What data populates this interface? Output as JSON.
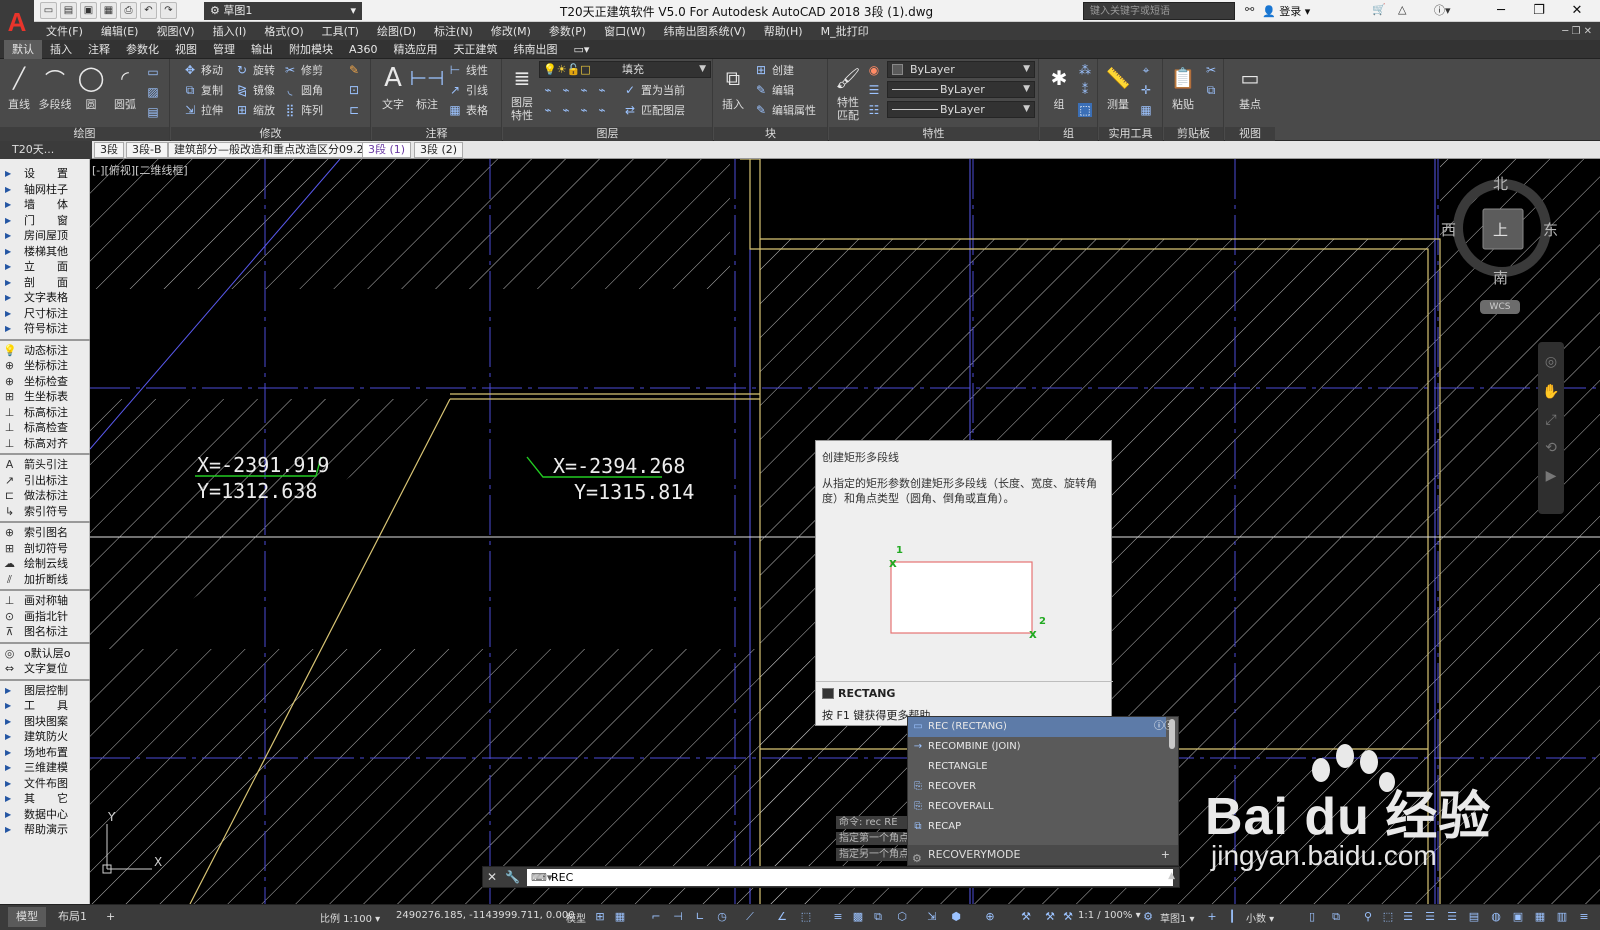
{
  "titlebar": {
    "workspace": "草图1",
    "title": "T20天正建筑软件 V5.0 For Autodesk AutoCAD 2018    3段 (1).dwg",
    "search_placeholder": "键入关键字或短语",
    "login": "登录"
  },
  "menus": [
    "文件(F)",
    "编辑(E)",
    "视图(V)",
    "插入(I)",
    "格式(O)",
    "工具(T)",
    "绘图(D)",
    "标注(N)",
    "修改(M)",
    "参数(P)",
    "窗口(W)",
    "纬南出图系统(V)",
    "帮助(H)",
    "M_批打印"
  ],
  "ribbon_tabs": [
    "默认",
    "插入",
    "注释",
    "参数化",
    "视图",
    "管理",
    "输出",
    "附加模块",
    "A360",
    "精选应用",
    "天正建筑",
    "纬南出图"
  ],
  "ribbon": {
    "draw": {
      "title": "绘图",
      "line": "直线",
      "polyline": "多段线",
      "circle": "圆",
      "arc": "圆弧"
    },
    "modify": {
      "title": "修改",
      "move": "移动",
      "rotate": "旋转",
      "trim": "修剪",
      "copy": "复制",
      "mirror": "镜像",
      "fillet": "圆角",
      "stretch": "拉伸",
      "scale": "缩放",
      "array": "阵列"
    },
    "annotation": {
      "title": "注释",
      "text": "文字",
      "dimension": "标注",
      "linear": "线性",
      "leader": "引线",
      "table": "表格"
    },
    "layers": {
      "title": "图层",
      "layer_props": "图层\n特性",
      "layer_name": "填充",
      "make_current": "置为当前",
      "match_layer": "匹配图层"
    },
    "block": {
      "title": "块",
      "insert": "插入",
      "create": "创建",
      "edit": "编辑",
      "edit_attr": "编辑属性"
    },
    "properties": {
      "title": "特性",
      "match": "特性\n匹配",
      "color": "ByLayer",
      "linetype": "ByLayer",
      "lineweight": "ByLayer"
    },
    "groups": {
      "title": "组",
      "group": "组"
    },
    "utilities": {
      "title": "实用工具",
      "measure": "测量"
    },
    "clipboard": {
      "title": "剪贴板",
      "paste": "粘贴"
    },
    "view": {
      "title": "视图",
      "base": "基点"
    }
  },
  "doc_tabs": {
    "panel_title": "T20天...",
    "tabs": [
      "3段",
      "3段-B",
      "建筑部分—般改造和重点改造区分09.22",
      "3段 (1)",
      "3段 (2)"
    ],
    "active": "3段 (1)"
  },
  "sidebar": {
    "group1": [
      "设　　置",
      "轴网柱子",
      "墙　　体",
      "门　　窗",
      "房间屋顶",
      "楼梯其他",
      "立　　面",
      "剖　　面",
      "文字表格",
      "尺寸标注",
      "符号标注"
    ],
    "group2": [
      "动态标注",
      "坐标标注",
      "坐标检查",
      "生坐标表",
      "标高标注",
      "标高检查",
      "标高对齐"
    ],
    "group3": [
      "箭头引注",
      "引出标注",
      "做法标注",
      "索引符号"
    ],
    "group4": [
      "索引图名",
      "剖切符号",
      "绘制云线",
      "加折断线"
    ],
    "group5": [
      "画对称轴",
      "画指北针",
      "图名标注"
    ],
    "group6": [
      "o默认层o",
      "文字复位"
    ],
    "group7": [
      "图层控制",
      "工　　具",
      "图块图案",
      "建筑防火",
      "场地布置",
      "三维建模",
      "文件布图",
      "其　　它",
      "数据中心",
      "帮助演示"
    ]
  },
  "canvas": {
    "view_label": "[-][俯视][二维线框]",
    "coord1_x": "X=-2391.919",
    "coord1_y": "Y=1312.638",
    "coord2_x": "X=-2394.268",
    "coord2_y": "Y=1315.814"
  },
  "viewcube": {
    "north": "北",
    "south": "南",
    "east": "东",
    "west": "西",
    "top": "上",
    "wcs": "WCS"
  },
  "tooltip": {
    "title": "创建矩形多段线",
    "description": "从指定的矩形参数创建矩形多段线（长度、宽度、旋转角度）和角点类型（圆角、倒角或直角）。",
    "point1": "1",
    "point2": "2",
    "command": "RECTANG",
    "help": "按 F1 键获得更多帮助"
  },
  "autocomplete": {
    "items": [
      "REC (RECTANG)",
      "RECOMBINE (JOIN)",
      "RECTANGLE",
      "RECOVER",
      "RECOVERALL",
      "RECAP"
    ],
    "footer": "RECOVERYMODE"
  },
  "command_history": [
    "命令: rec RE",
    "指定第一个角点",
    "指定另一个角点"
  ],
  "command_line": {
    "input": "REC"
  },
  "statusbar": {
    "model_tab": "模型",
    "layout_tab": "布局1",
    "scale": "比例 1:100",
    "coords": "2490276.185, -1143999.711, 0.000",
    "mode": "模型",
    "annotation_scale": "1:1 / 100%",
    "workspace": "草图1",
    "units": "小数"
  },
  "watermark": {
    "main": "Bai du 经验",
    "sub": "jingyan.baidu.com"
  },
  "colors": {
    "accent": "#5d7ba8",
    "ribbon": "#4a4a4a",
    "canvas": "#000000",
    "tooltip": "#efefef",
    "red_rect": "#e57373",
    "green_mark": "#22cc22"
  }
}
